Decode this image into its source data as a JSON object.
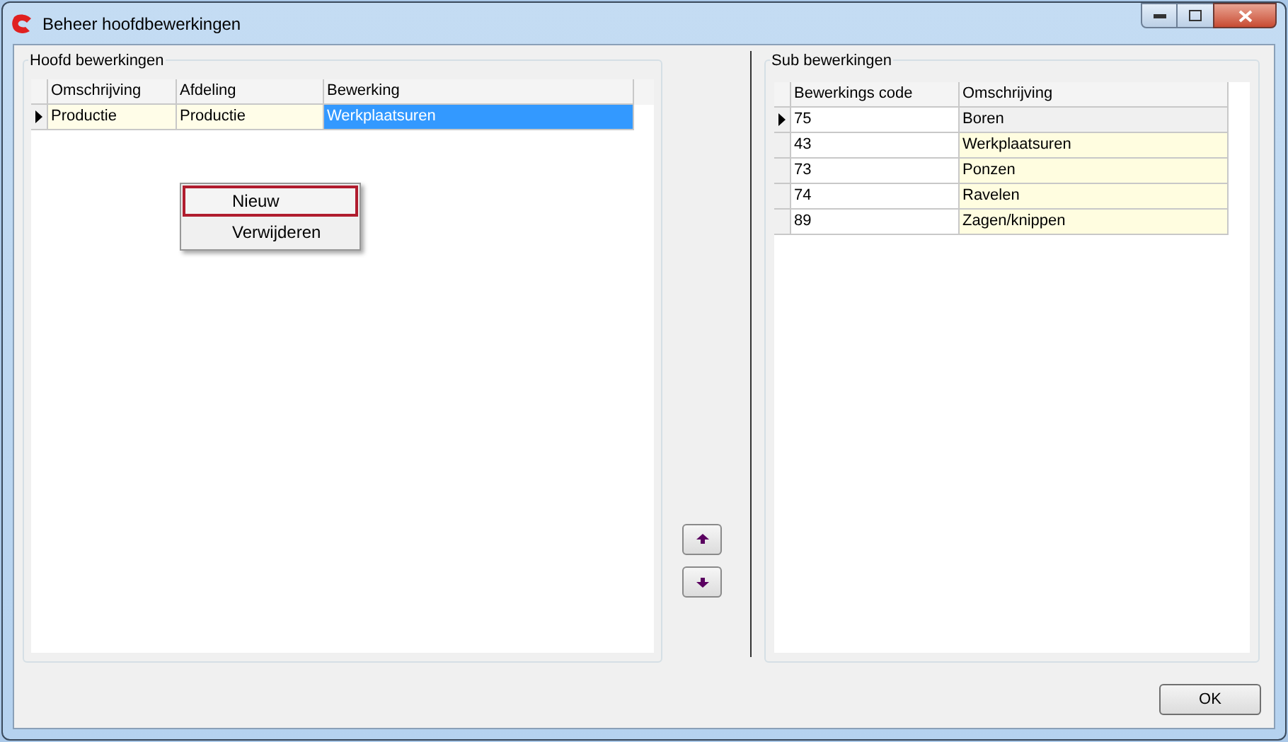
{
  "window": {
    "title": "Beheer hoofdbewerkingen"
  },
  "main_group": {
    "title": "Hoofd bewerkingen",
    "columns": [
      "Omschrijving",
      "Afdeling",
      "Bewerking"
    ],
    "rows": [
      {
        "selected": true,
        "cells": [
          {
            "text": "Productie",
            "selected": false
          },
          {
            "text": "Productie",
            "selected": false
          },
          {
            "text": "Werkplaatsuren",
            "selected": true
          }
        ]
      }
    ]
  },
  "context_menu": [
    {
      "label": "Nieuw",
      "selected": true
    },
    {
      "label": "Verwijderen",
      "selected": false
    }
  ],
  "sub_group": {
    "title": "Sub bewerkingen",
    "columns": [
      "Bewerkings code",
      "Omschrijving"
    ],
    "rows": [
      {
        "selected": true,
        "cells": [
          "75",
          "Boren"
        ]
      },
      {
        "selected": false,
        "cells": [
          "43",
          "Werkplaatsuren"
        ]
      },
      {
        "selected": false,
        "cells": [
          "73",
          "Ponzen"
        ]
      },
      {
        "selected": false,
        "cells": [
          "74",
          "Ravelen"
        ]
      },
      {
        "selected": false,
        "cells": [
          "89",
          "Zagen/knippen"
        ]
      }
    ]
  },
  "buttons": {
    "ok": "OK"
  }
}
